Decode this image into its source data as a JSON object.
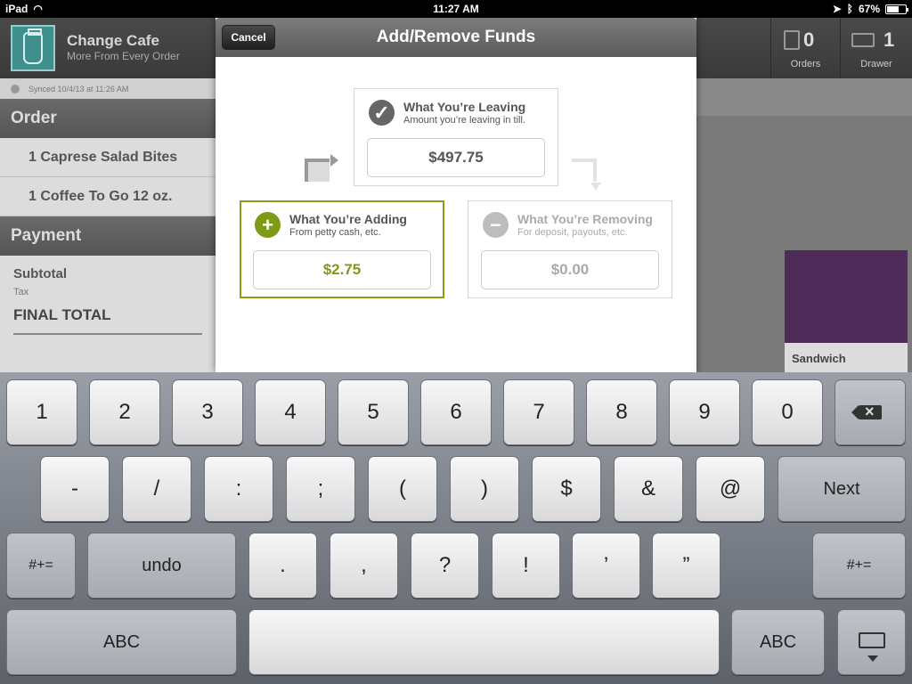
{
  "status_bar": {
    "device": "iPad",
    "time": "11:27 AM",
    "battery": "67%",
    "battery_level": 0.67
  },
  "app": {
    "title": "Change Cafe",
    "subtitle": "More From Every Order"
  },
  "header_stats": [
    {
      "count": "0",
      "label": "Orders",
      "icon": "orders-icon"
    },
    {
      "count": "1",
      "label": "Drawer",
      "icon": "cash-drawer-icon"
    }
  ],
  "sidebar": {
    "synced": "Synced 10/4/13 at 11:26 AM",
    "order_header": "Order",
    "order_items": [
      "1 Caprese Salad Bites",
      "1 Coffee To Go 12 oz."
    ],
    "payment_header": "Payment",
    "subtotal_label": "Subtotal",
    "tax_label": "Tax",
    "final_total_label": "FINAL TOTAL"
  },
  "product_tile": {
    "label": "Sandwich",
    "color": "#4f2b5a"
  },
  "modal": {
    "title": "Add/Remove Funds",
    "cancel_label": "Cancel",
    "leaving": {
      "title": "What You’re Leaving",
      "subtitle": "Amount you’re leaving in till.",
      "value": "$497.75",
      "icon": "checkmark-icon"
    },
    "adding": {
      "title": "What You’re Adding",
      "subtitle": "From petty cash, etc.",
      "value": "$2.75",
      "icon": "plus-icon",
      "accent": "#7f9a16"
    },
    "removing": {
      "title": "What You’re Removing",
      "subtitle": "For deposit, payouts, etc.",
      "value": "$0.00",
      "icon": "minus-icon"
    }
  },
  "keyboard": {
    "row1": [
      "1",
      "2",
      "3",
      "4",
      "5",
      "6",
      "7",
      "8",
      "9",
      "0"
    ],
    "row2": [
      "-",
      "/",
      ":",
      ";",
      "(",
      ")",
      "$",
      "&",
      "@"
    ],
    "next_label": "Next",
    "row3_left": "#+=",
    "undo_label": "undo",
    "row3": [
      ".",
      ",",
      "?",
      "!",
      "’",
      "”"
    ],
    "row3_right": "#+=",
    "abc_left": "ABC",
    "abc_right": "ABC"
  }
}
